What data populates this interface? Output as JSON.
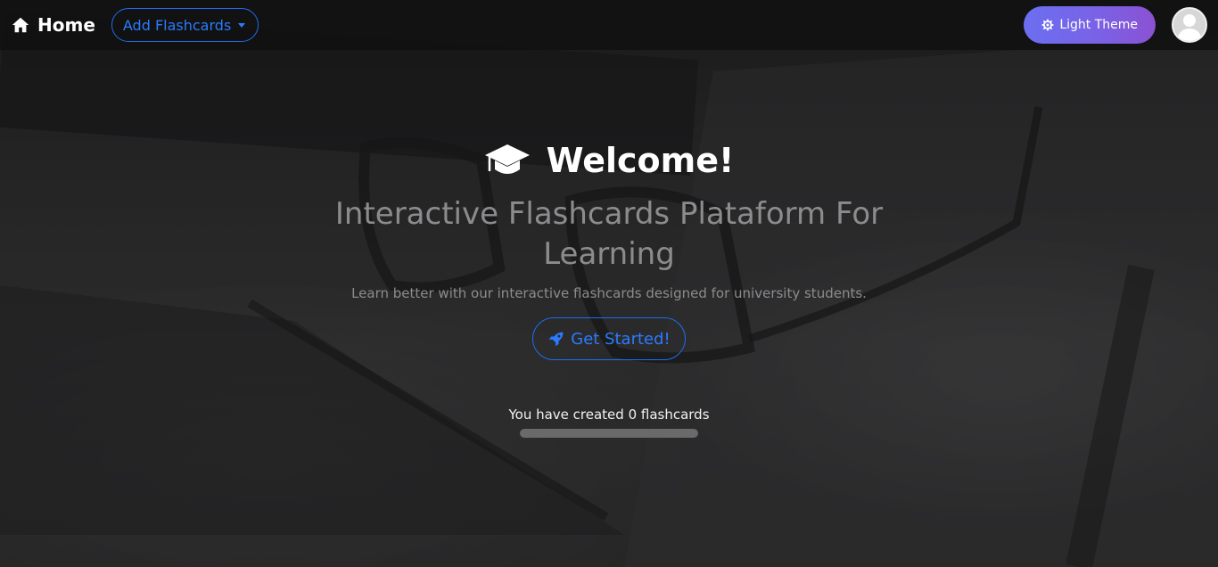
{
  "navbar": {
    "brand_label": "Home",
    "add_menu_label": "Add Flashcards",
    "theme_button_label": "Light Theme"
  },
  "hero": {
    "title": "Welcome!",
    "subtitle": "Interactive Flashcards Plataform For Learning",
    "lead": "Learn better with our interactive flashcards designed for university students.",
    "cta_label": "Get Started!"
  },
  "stats": {
    "counter_text": "You have created 0 flashcards",
    "progress_fraction": 0
  },
  "colors": {
    "accent": "#2a7bff",
    "theme_gradient_start": "#6b6ff0",
    "theme_gradient_end": "#8a52d2",
    "muted_text": "#8c8c8e"
  },
  "icons": {
    "brand": "home-icon",
    "theme": "gear-icon",
    "title": "graduation-cap-icon",
    "cta": "rocket-icon",
    "avatar": "user-icon"
  }
}
